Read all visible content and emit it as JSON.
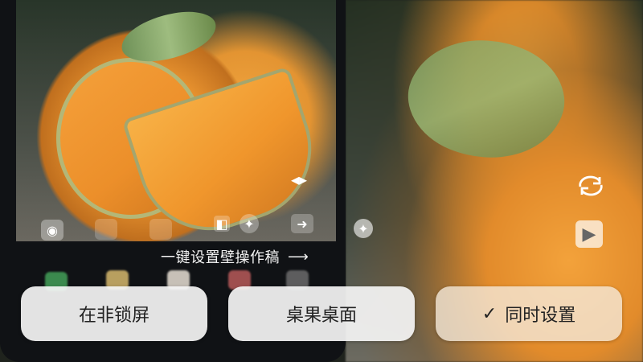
{
  "hint": {
    "text": "一键设置壁操作稿",
    "arrow": "⟶"
  },
  "buttons": [
    {
      "label": "在非锁屏"
    },
    {
      "label": "桌果桌面"
    },
    {
      "label": "同时设置",
      "icon": "check-icon",
      "selected": true
    }
  ]
}
